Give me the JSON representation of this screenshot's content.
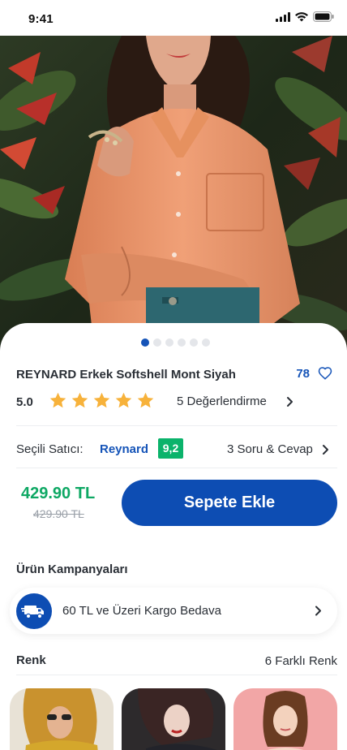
{
  "status_bar": {
    "time": "9:41"
  },
  "hero": {
    "image_dots": 6,
    "active_dot": 0
  },
  "product": {
    "title": "REYNARD Erkek Softshell Mont Siyah",
    "likes": "78",
    "rating": "5.0",
    "stars": 5,
    "reviews_label": "5 Değerlendirme"
  },
  "seller": {
    "label": "Seçili Satıcı:",
    "name": "Reynard",
    "score": "9,2",
    "qa_label": "3 Soru & Cevap"
  },
  "pricing": {
    "price": "429.90 TL",
    "old_price": "429.90 TL",
    "cta_label": "Sepete Ekle"
  },
  "campaigns": {
    "title": "Ürün Kampanyaları",
    "items": [
      {
        "label": "60 TL ve Üzeri Kargo Bedava",
        "icon": "truck-icon"
      }
    ]
  },
  "colors": {
    "title": "Renk",
    "count_label": "6 Farklı Renk"
  },
  "theme": {
    "primary": "#0d4db3",
    "price_green": "#0ea864",
    "score_green": "#0bb36b",
    "star": "#f7b23b"
  }
}
